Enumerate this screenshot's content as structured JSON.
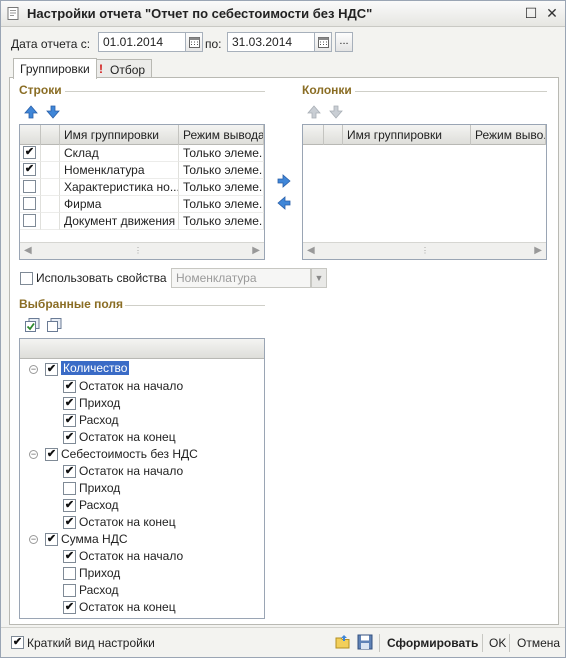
{
  "window": {
    "title": "Настройки отчета \"Отчет по себестоимости без НДС\"",
    "minimize_glyph": "☐",
    "close_glyph": "✕"
  },
  "period": {
    "from_label": "Дата отчета с:",
    "from_value": "01.01.2014",
    "to_label": "по:",
    "to_value": "31.03.2014",
    "ellipsis_label": "..."
  },
  "tabs": [
    {
      "label": "Группировки",
      "active": true
    },
    {
      "label": "Отбор",
      "active": false,
      "marker": "!"
    }
  ],
  "rows_section": {
    "title": "Строки",
    "columns": [
      "Имя группировки",
      "Режим вывода"
    ],
    "items": [
      {
        "checked": true,
        "name": "Склад",
        "mode": "Только элеме..."
      },
      {
        "checked": true,
        "name": "Номенклатура",
        "mode": "Только элеме..."
      },
      {
        "checked": false,
        "name": "Характеристика но...",
        "mode": "Только элеме..."
      },
      {
        "checked": false,
        "name": "Фирма",
        "mode": "Только элеме..."
      },
      {
        "checked": false,
        "name": "Документ движения",
        "mode": "Только элеме..."
      }
    ]
  },
  "columns_section": {
    "title": "Колонки",
    "columns": [
      "Имя группировки",
      "Режим выво..."
    ]
  },
  "use_properties": {
    "label": "Использовать свойства",
    "checked": false,
    "combo_value": "Номенклатура"
  },
  "selected_fields": {
    "title": "Выбранные поля",
    "groups": [
      {
        "label": "Количество",
        "checked": true,
        "selected": true,
        "children": [
          {
            "label": "Остаток на начало",
            "checked": true
          },
          {
            "label": "Приход",
            "checked": true
          },
          {
            "label": "Расход",
            "checked": true
          },
          {
            "label": "Остаток на конец",
            "checked": true
          }
        ]
      },
      {
        "label": "Себестоимость без НДС",
        "checked": true,
        "selected": false,
        "children": [
          {
            "label": "Остаток на начало",
            "checked": true
          },
          {
            "label": "Приход",
            "checked": false
          },
          {
            "label": "Расход",
            "checked": true
          },
          {
            "label": "Остаток на конец",
            "checked": true
          }
        ]
      },
      {
        "label": "Сумма НДС",
        "checked": true,
        "selected": false,
        "children": [
          {
            "label": "Остаток на начало",
            "checked": true
          },
          {
            "label": "Приход",
            "checked": false
          },
          {
            "label": "Расход",
            "checked": false
          },
          {
            "label": "Остаток на конец",
            "checked": true
          }
        ]
      }
    ]
  },
  "bottom": {
    "short_view_label": "Краткий вид настройки",
    "short_view_checked": true,
    "generate_label": "Сформировать",
    "ok_label": "OK",
    "cancel_label": "Отмена"
  },
  "colors": {
    "section_title": "#8a6d24",
    "selection": "#3a6bc6",
    "arrow_blue": "#3f86d8",
    "alert_red": "#d21a1a"
  }
}
